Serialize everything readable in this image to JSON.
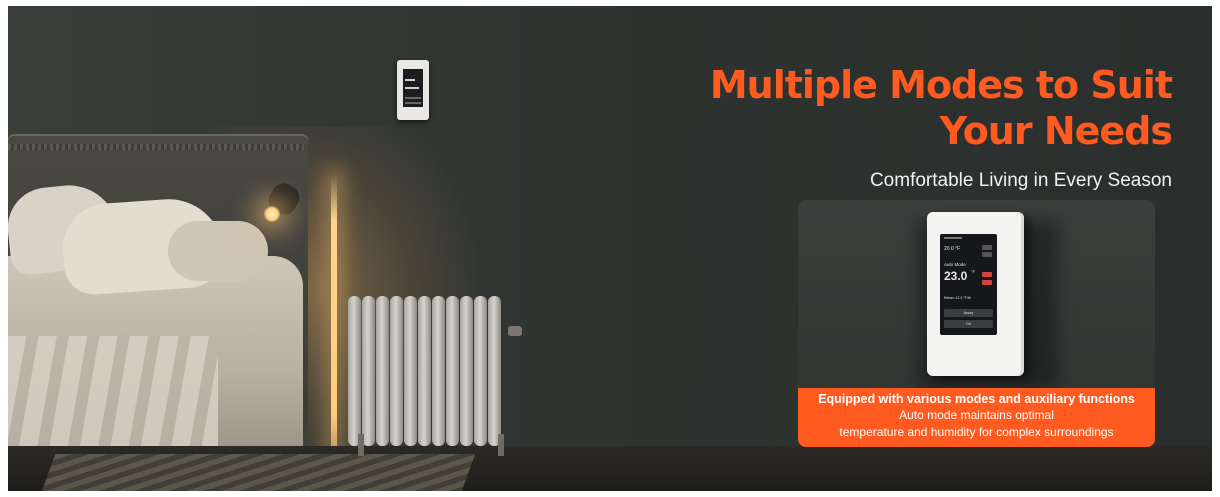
{
  "banner": {
    "headline_line1": "Multiple Modes to Suit",
    "headline_line2": "Your Needs",
    "subheading": "Comfortable Living in Every Season",
    "accent_color": "#ff5a1f"
  },
  "product_card": {
    "screen": {
      "temp_small": "20.0 °F",
      "mode_label": "Auto Mode",
      "temp_large": "23.0",
      "temp_unit": "°F",
      "return_text": "Return 12.0 °F/Hr",
      "button1_label": "Away",
      "button2_label": "On"
    },
    "caption_line1": "Equipped with various modes and auxiliary functions",
    "caption_line2": "Auto mode maintains optimal",
    "caption_line3": "temperature and humidity for complex surroundings"
  }
}
